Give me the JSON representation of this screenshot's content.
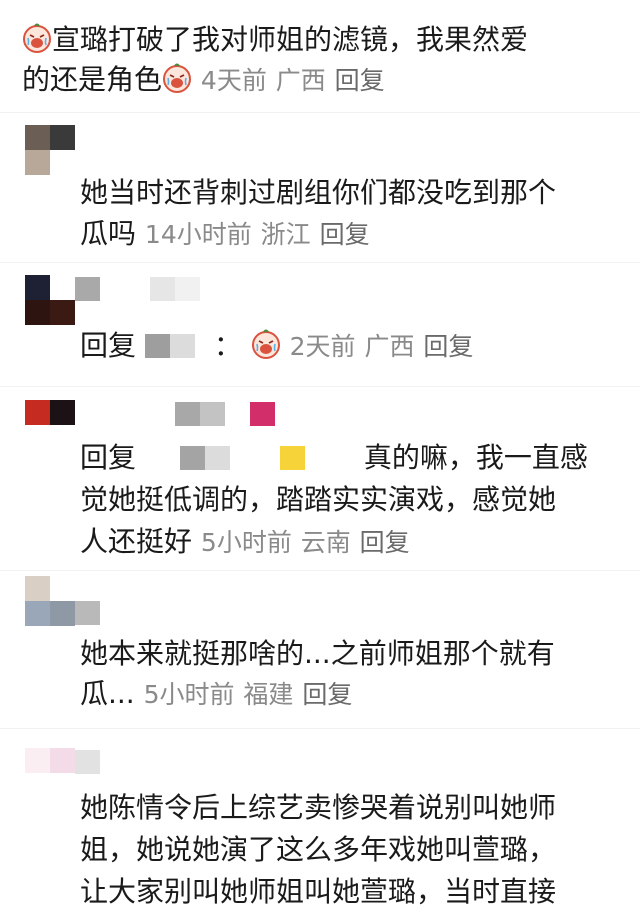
{
  "comments": [
    {
      "line1": "宣璐打破了我对师姐的滤镜，我果然爱",
      "line2": "的还是角色",
      "time": "4天前",
      "location": "广西",
      "reply": "回复"
    },
    {
      "line1": "她当时还背刺过剧组你们都没吃到那个",
      "line2": "瓜吗",
      "time": "14小时前",
      "location": "浙江",
      "reply": "回复"
    },
    {
      "prefix": "回复",
      "colon": "：",
      "time": "2天前",
      "location": "广西",
      "reply": "回复"
    },
    {
      "prefix": "回复",
      "line1_tail": "真的嘛，我一直感",
      "line2": "觉她挺低调的，踏踏实实演戏，感觉她",
      "line3": "人还挺好",
      "time": "5小时前",
      "location": "云南",
      "reply": "回复"
    },
    {
      "line1": "她本来就挺那啥的...之前师姐那个就有",
      "line2": "瓜...",
      "time": "5小时前",
      "location": "福建",
      "reply": "回复"
    },
    {
      "line1": "她陈情令后上综艺卖惨哭着说别叫她师",
      "line2": "姐，她说她演了这么多年戏她叫萱璐，",
      "line3": "让大家别叫她师姐叫她萱璐，当时直接"
    }
  ],
  "colors": {
    "text": "#1a1a1a",
    "meta": "#8a8a8a",
    "background": "#ffffff"
  },
  "icons": [
    "crying-face-emoji-icon"
  ]
}
